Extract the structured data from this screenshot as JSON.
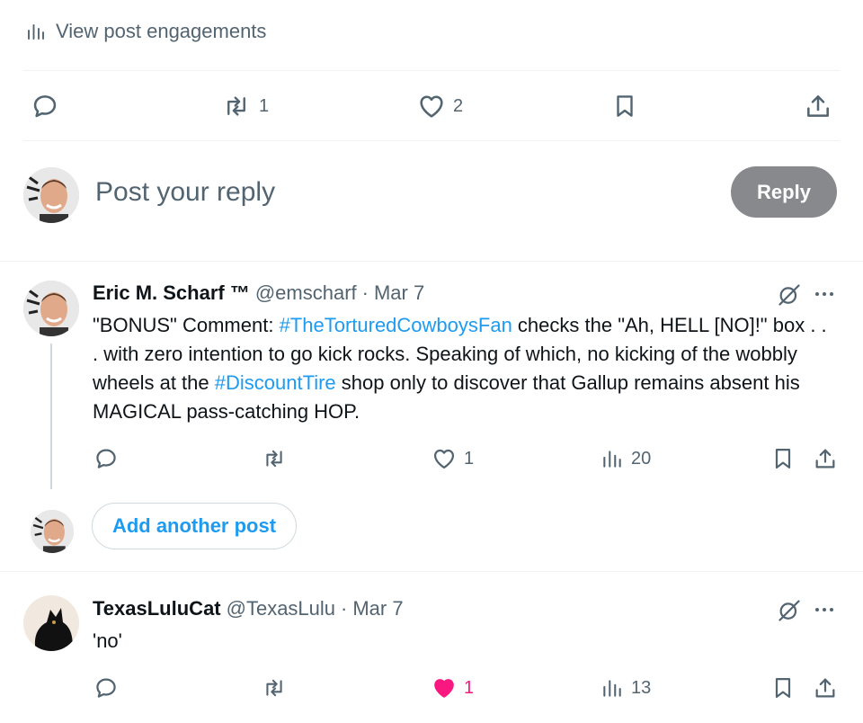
{
  "engagements": {
    "label": "View post engagements",
    "icon": "bar-chart-icon"
  },
  "main_post_actions": {
    "reply": {
      "icon": "reply-icon",
      "count": ""
    },
    "repost": {
      "icon": "repost-icon",
      "count": "1"
    },
    "like": {
      "icon": "heart-icon",
      "count": "2"
    },
    "bookmark": {
      "icon": "bookmark-icon"
    },
    "share": {
      "icon": "share-icon"
    }
  },
  "compose": {
    "placeholder": "Post your reply",
    "button": "Reply"
  },
  "thread": [
    {
      "name": "Eric M. Scharf ™",
      "handle": "@emscharf",
      "separator": "·",
      "date": "Mar 7",
      "text_segments": [
        {
          "t": "\"BONUS\" Comment: ",
          "link": false
        },
        {
          "t": "#TheTorturedCowboysFan",
          "link": true
        },
        {
          "t": " checks the \"Ah, HELL [NO]!\" box . . . with zero intention to go kick rocks. Speaking of which, no kicking of the wobbly wheels at the ",
          "link": false
        },
        {
          "t": "#DiscountTire",
          "link": true
        },
        {
          "t": " shop only to discover that Gallup remains absent his MAGICAL pass-catching HOP.",
          "link": false
        }
      ],
      "actions": {
        "reply": "",
        "repost": "",
        "like": "1",
        "views": "20"
      },
      "liked": false
    },
    {
      "name": "TexasLuluCat",
      "handle": "@TexasLulu",
      "separator": "·",
      "date": "Mar 7",
      "text_segments": [
        {
          "t": "'no'",
          "link": false
        }
      ],
      "actions": {
        "reply": "",
        "repost": "",
        "like": "1",
        "views": "13"
      },
      "liked": true
    }
  ],
  "add_another": {
    "label": "Add another post"
  },
  "colors": {
    "accent": "#1d9bf0",
    "like": "#f91880",
    "muted": "#536471",
    "button_disabled": "#87898c"
  }
}
